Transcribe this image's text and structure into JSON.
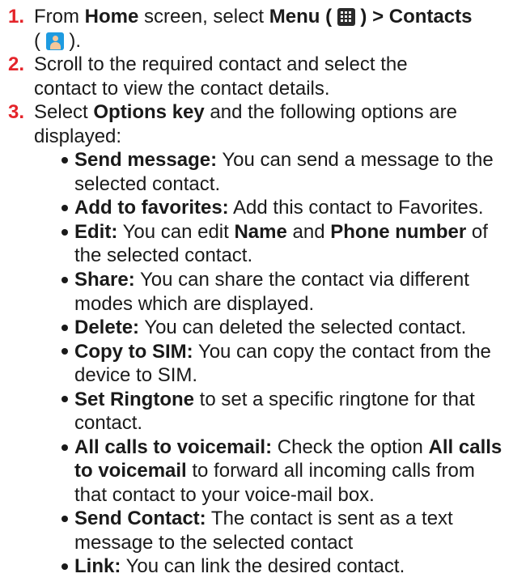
{
  "colors": {
    "step_number": "#e4242a",
    "text": "#1a1a1a",
    "contacts_icon": "#1e9be0",
    "menu_icon": "#2b2b2b"
  },
  "steps": [
    {
      "number": "1.",
      "parts": [
        "From ",
        "Home",
        " screen, select ",
        "Menu",
        " ( ",
        " ) > Contacts",
        " ( ",
        " )."
      ],
      "menu_icon": "menu-grid-icon",
      "contacts_icon": "contacts-person-icon"
    },
    {
      "number": "2.",
      "lines": [
        "Scroll to the required contact and select the",
        "contact to view the contact details."
      ]
    },
    {
      "number": "3.",
      "parts": [
        "Select ",
        "Options key",
        " and the following options are"
      ],
      "line2": "displayed:"
    }
  ],
  "options": [
    {
      "label": "Send message:",
      "lines": [
        "  You can send a message to the",
        "selected contact."
      ]
    },
    {
      "label": "Add to favorites:",
      "lines": [
        " Add this contact to Favorites."
      ]
    },
    {
      "label": "Edit:",
      "l1a": " You can edit ",
      "b1": "Name",
      "l1b": " and ",
      "b2": "Phone number",
      "l1c": " of",
      "l2": "the selected contact."
    },
    {
      "label": "Share:",
      "lines": [
        " You can share the contact via different",
        "modes which are displayed."
      ]
    },
    {
      "label": "Delete:",
      "lines": [
        " You can deleted the selected contact."
      ]
    },
    {
      "label": "Copy to SIM:",
      "lines": [
        " You can copy the contact from the",
        "device to SIM."
      ]
    },
    {
      "label": "Set Ringtone",
      "lines": [
        " to set a specific ringtone for that",
        "contact."
      ]
    },
    {
      "label": "All calls to voicemail:",
      "l1a": " Check the option ",
      "b1": "All calls",
      "b2": "to voicemail",
      "l2": " to forward all incoming calls from",
      "l3": "that contact to your voice-mail box."
    },
    {
      "label": "Send Contact:",
      "lines": [
        " The contact is sent as a text",
        "message to the selected contact"
      ]
    },
    {
      "label": "Link:",
      "lines": [
        " You can link the desired contact."
      ]
    }
  ]
}
